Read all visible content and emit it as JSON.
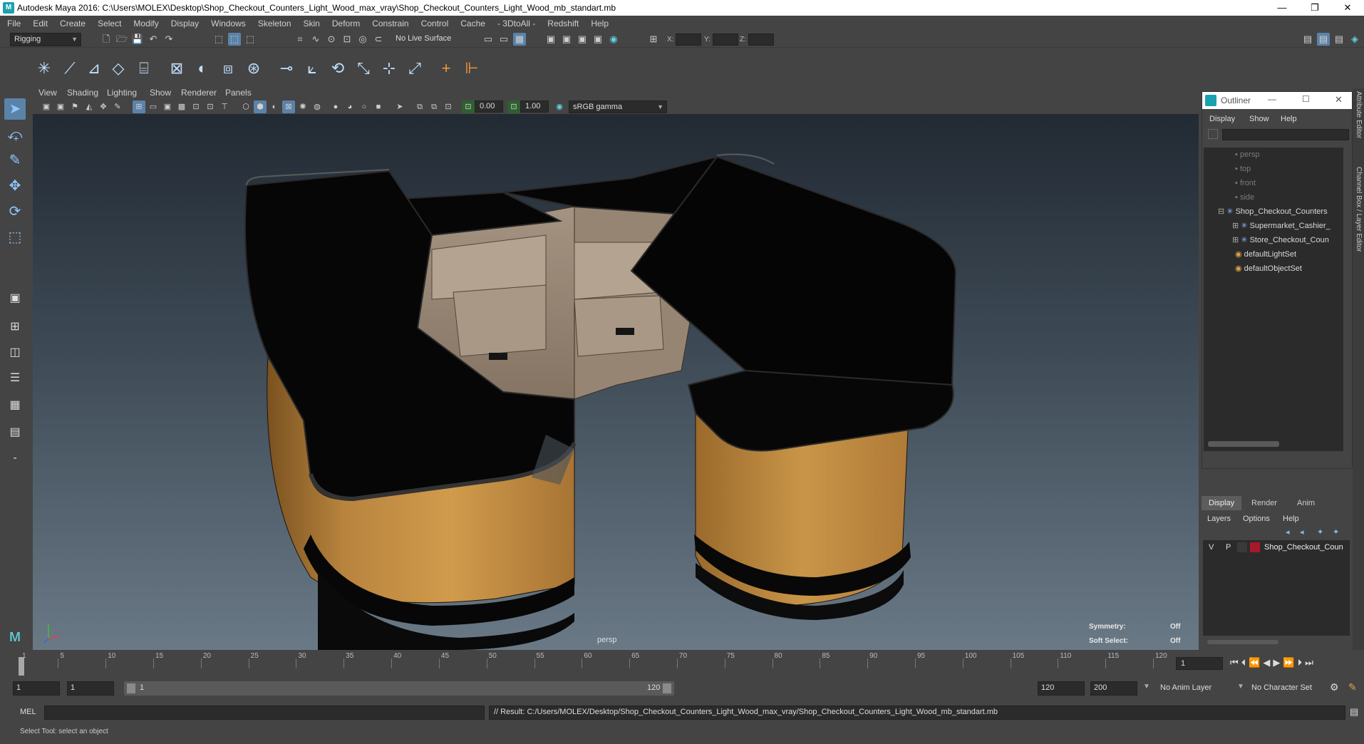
{
  "window": {
    "title": "Autodesk Maya 2016: C:\\Users\\MOLEX\\Desktop\\Shop_Checkout_Counters_Light_Wood_max_vray\\Shop_Checkout_Counters_Light_Wood_mb_standart.mb",
    "minimize": "—",
    "restore": "❐",
    "close": "✕"
  },
  "menubar": [
    "File",
    "Edit",
    "Create",
    "Select",
    "Modify",
    "Display",
    "Windows",
    "Skeleton",
    "Skin",
    "Deform",
    "Constrain",
    "Control",
    "Cache",
    "- 3DtoAll -",
    "Redshift",
    "Help"
  ],
  "statusline": {
    "menuset": "Rigging",
    "live_surface": "No Live Surface",
    "x_label": "X:",
    "y_label": "Y:",
    "z_label": "Z:"
  },
  "panel_menu": [
    "View",
    "Shading",
    "Lighting",
    "Show",
    "Renderer",
    "Panels"
  ],
  "panel_toolbar": {
    "exposure": "0.00",
    "gamma": "1.00",
    "colorspace": "sRGB gamma"
  },
  "viewport": {
    "camera_label": "persp",
    "symmetry_label": "Symmetry:",
    "symmetry_value": "Off",
    "softselect_label": "Soft Select:",
    "softselect_value": "Off"
  },
  "outliner": {
    "title": "Outliner",
    "menu": [
      "Display",
      "Show",
      "Help"
    ],
    "items": [
      {
        "label": "persp",
        "dim": true
      },
      {
        "label": "top",
        "dim": true
      },
      {
        "label": "front",
        "dim": true
      },
      {
        "label": "side",
        "dim": true
      },
      {
        "label": "Shop_Checkout_Counters",
        "dim": false
      },
      {
        "label": "Supermarket_Cashier_",
        "dim": false
      },
      {
        "label": "Store_Checkout_Coun",
        "dim": false
      },
      {
        "label": "defaultLightSet",
        "dim": false
      },
      {
        "label": "defaultObjectSet",
        "dim": false
      }
    ]
  },
  "layer_editor": {
    "tabs": [
      "Display",
      "Render",
      "Anim"
    ],
    "menu": [
      "Layers",
      "Options",
      "Help"
    ],
    "layer": {
      "v": "V",
      "p": "P",
      "name": "Shop_Checkout_Coun",
      "color": "#a8182c"
    }
  },
  "side_tabs": {
    "attribute_editor": "Attribute Editor",
    "channel_box": "Channel Box / Layer Editor"
  },
  "timeslider": {
    "ticks": [
      1,
      5,
      10,
      15,
      20,
      25,
      30,
      35,
      40,
      45,
      50,
      55,
      60,
      65,
      70,
      75,
      80,
      85,
      90,
      95,
      100,
      105,
      110,
      115,
      120
    ],
    "current_frame": "1"
  },
  "range": {
    "start": "1",
    "start2": "1",
    "slider_start": "1",
    "slider_end": "120",
    "end": "120",
    "end2": "200",
    "anim_layer": "No Anim Layer",
    "character_set": "No Character Set"
  },
  "cmdline": {
    "mode": "MEL",
    "result": "// Result: C:/Users/MOLEX/Desktop/Shop_Checkout_Counters_Light_Wood_max_vray/Shop_Checkout_Counters_Light_Wood_mb_standart.mb"
  },
  "helpline": {
    "text": "Select Tool: select an object"
  },
  "colors": {
    "ui_bg": "#444444",
    "accent": "#5fd3e0",
    "wood": "#c08a3e",
    "countertop": "#080808"
  }
}
